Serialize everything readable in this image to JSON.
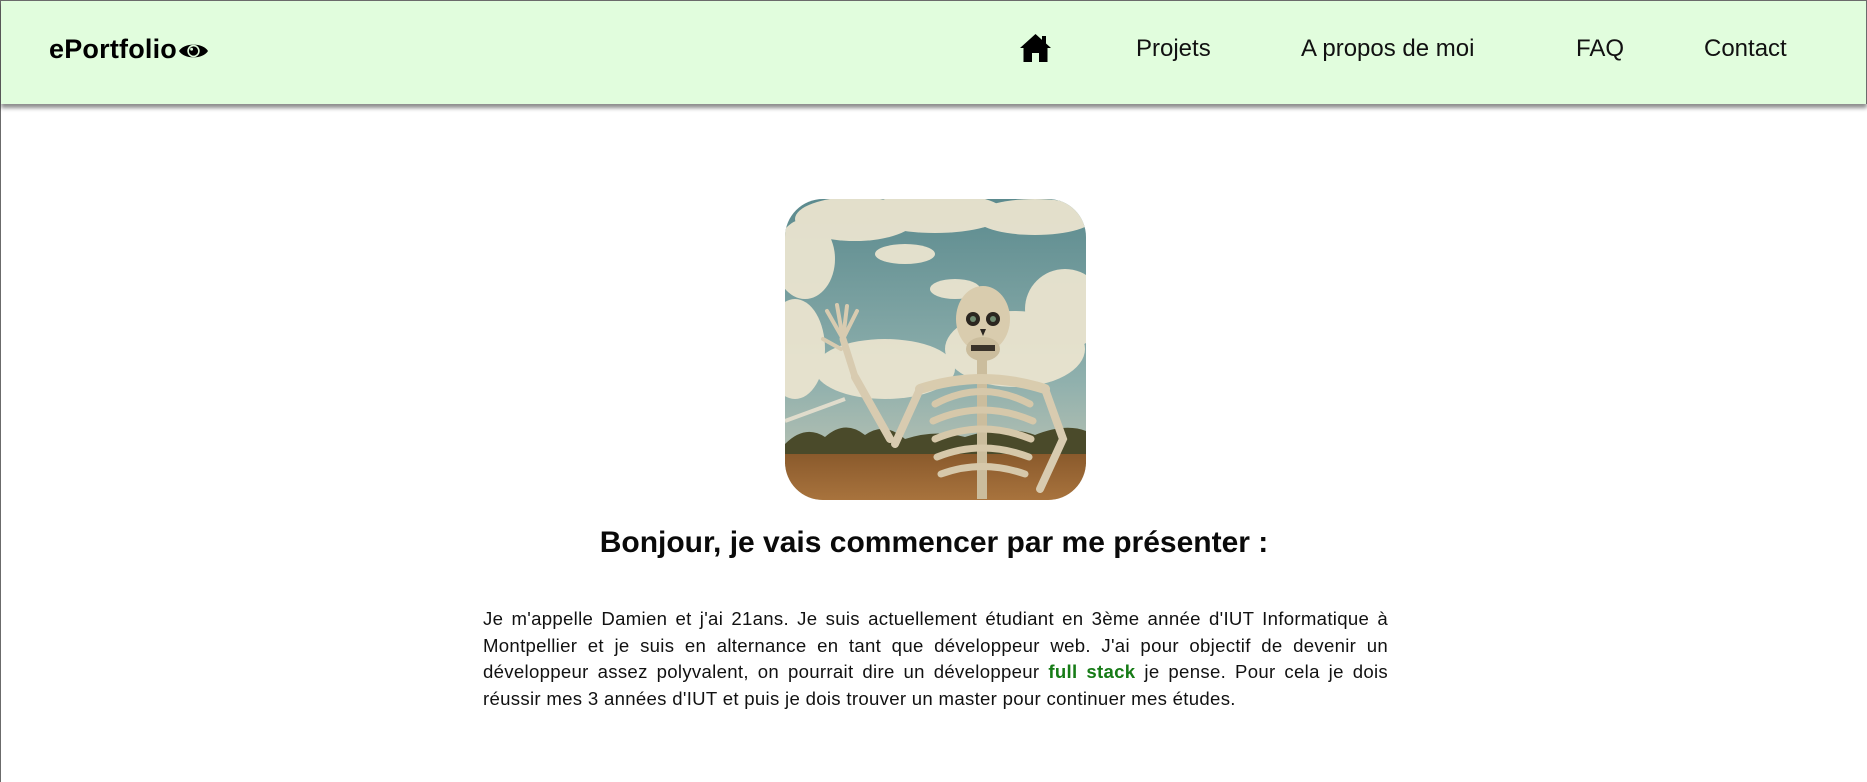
{
  "nav": {
    "brand": "ePortfolio",
    "brand_icon": "eye-icon",
    "home_icon": "home-icon",
    "links": [
      "Projets",
      "A propos de moi",
      "FAQ",
      "Contact"
    ],
    "background_color": "#e1fddd"
  },
  "main": {
    "avatar_alt": "skeleton waving",
    "heading": "Bonjour, je vais commencer par me présenter :",
    "intro": {
      "before": "Je m'appelle Damien et j'ai 21ans. Je suis actuellement étudiant en 3ème année d'IUT Informatique à Montpellier et je suis en alternance en tant que développeur web. J'ai pour objectif de devenir un développeur assez polyvalent, on pourrait dire un développeur ",
      "highlight": "full stack",
      "after": " je pense. Pour cela je dois réussir mes 3 années d'IUT et puis je dois trouver un master pour continuer mes études.",
      "highlight_color": "#167b16"
    }
  }
}
